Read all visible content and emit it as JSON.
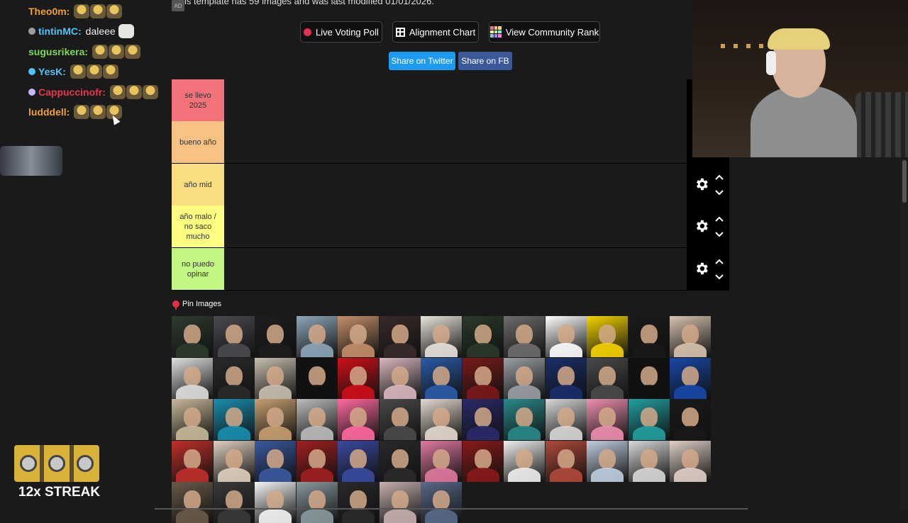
{
  "page": {
    "info_text": "is template has 59 images and was last modified 01/01/2026.",
    "ad_badge": "AD"
  },
  "buttons": {
    "live_voting": "Live Voting Poll",
    "alignment_chart": "Alignment Chart",
    "community_rank": "View Community Rank",
    "share_twitter": "Share on Twitter",
    "share_fb": "Share on FB"
  },
  "colors": {
    "twitter": "#1d9bf0",
    "facebook": "#3b5998",
    "live_dot": "#e0304e"
  },
  "tiers": [
    {
      "label": "se llevo 2025",
      "color": "#f2727a"
    },
    {
      "label": "bueno año",
      "color": "#f7c282"
    },
    {
      "label": "año mid",
      "color": "#f8dd82"
    },
    {
      "label": "año malo / no saco mucho",
      "color": "#fdfd82"
    },
    {
      "label": "no puedo opinar",
      "color": "#c3f582"
    }
  ],
  "pin_images_label": "Pin Images",
  "chat": {
    "messages": [
      {
        "user": "Theo0m:",
        "color": "#f0a030",
        "message": "",
        "badge": "",
        "emotes": 2,
        "cat": false
      },
      {
        "user": "tintinMC:",
        "color": "#4fc3f7",
        "message": "daleee",
        "badge": "#9e9e9e",
        "emotes": 0,
        "cat": true
      },
      {
        "user": "sugusrikera:",
        "color": "#7ed957",
        "message": "",
        "badge": "",
        "emotes": 2,
        "cat": false
      },
      {
        "user": "YesK:",
        "color": "#4fc3f7",
        "message": "",
        "badge": "#4fc3f7",
        "emotes": 2,
        "cat": false
      },
      {
        "user": "Cappuccinofr:",
        "color": "#e8374c",
        "message": "",
        "badge": "#c8b6ff",
        "emotes": 2,
        "cat": false
      },
      {
        "user": "ludddell:",
        "color": "#f0a030",
        "message": "",
        "badge": "",
        "emotes": 2,
        "cat": false
      }
    ],
    "streak_label": "12x STREAK"
  },
  "pool": {
    "count": 59,
    "palette": [
      "#2f3b2f",
      "#4a4a52",
      "#1e1e1e",
      "#8fa6b8",
      "#c58f6b",
      "#3a2a2a",
      "#e7e4dc",
      "#2a3a2a",
      "#6d6d6d",
      "#ffffff",
      "#f5d400",
      "#1a1a1a",
      "#d8c3b0",
      "#e0e0e0",
      "#2a2a2a",
      "#c9c0b0",
      "#111111",
      "#d01018",
      "#d9b8c0",
      "#2b5ca8",
      "#7a1a1a",
      "#9aa0a6",
      "#1a2f6a",
      "#4a4a4a",
      "#111111",
      "#1848a8",
      "#c9b99a",
      "#1a8fb0",
      "#c8a070",
      "#bdbdbd",
      "#ff6aa0",
      "#4a4a4a",
      "#e6dad0",
      "#2a2a6a",
      "#2a8a8a",
      "#d8d8d8",
      "#f08fb0",
      "#22a0a0",
      "#1a1a1a",
      "#c0302a",
      "#e0d0c0",
      "#3a5aa0",
      "#a02020",
      "#3a4aa0",
      "#2a2a2a",
      "#e07aa0",
      "#8a1a1a",
      "#f0f0f0",
      "#b04a3a",
      "#c0d0e0",
      "#d8d8d8",
      "#e0d0c8",
      "#6a5a4a",
      "#3a3a3a",
      "#f5f5f5",
      "#8a9aa0",
      "#2a2a2a",
      "#c8b0b0",
      "#5a6a8a"
    ]
  }
}
